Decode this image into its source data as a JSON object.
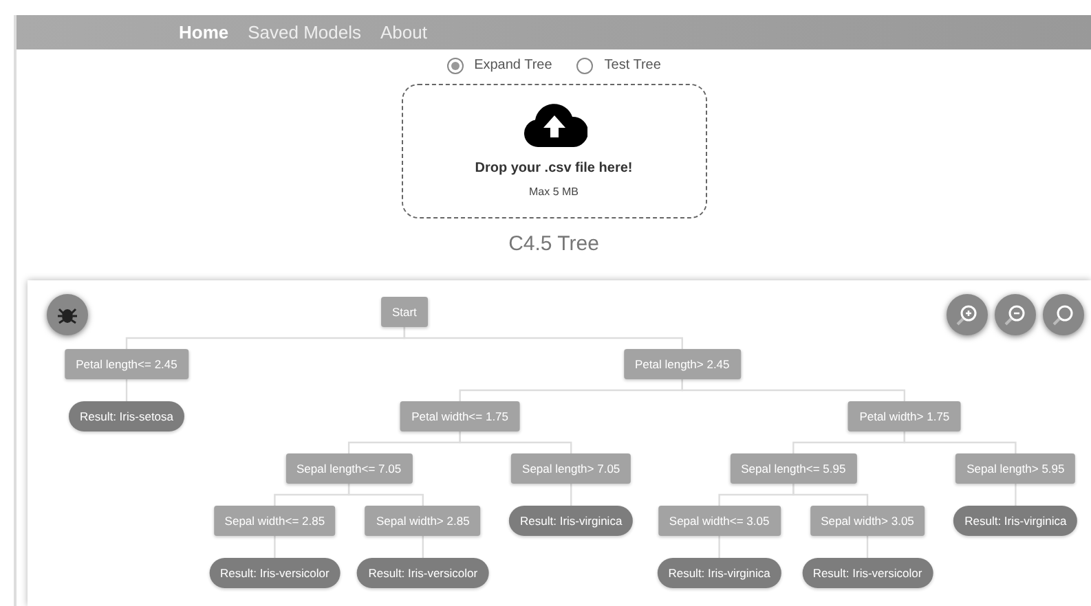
{
  "nav": [
    {
      "label": "Home",
      "selected": true
    },
    {
      "label": "Saved Models",
      "selected": false
    },
    {
      "label": "About",
      "selected": false
    }
  ],
  "mode_options": [
    {
      "label": "Expand Tree",
      "selected": true
    },
    {
      "label": "Test Tree",
      "selected": false
    }
  ],
  "dropzone": {
    "title": "Drop your .csv file here!",
    "hint": "Max 5 MB"
  },
  "heading": "C4.5 Tree",
  "tree": {
    "kind": "split",
    "label": "Start",
    "children": [
      {
        "kind": "split",
        "label": "Petal length<= 2.45",
        "children": [
          {
            "kind": "result",
            "label": "Result: Iris-setosa"
          }
        ]
      },
      {
        "kind": "split",
        "label": "Petal length> 2.45",
        "children": [
          {
            "kind": "split",
            "label": "Petal width<= 1.75",
            "children": [
              {
                "kind": "split",
                "label": "Sepal length<= 7.05",
                "children": [
                  {
                    "kind": "split",
                    "label": "Sepal width<= 2.85",
                    "children": [
                      {
                        "kind": "result",
                        "label": "Result: Iris-versicolor"
                      }
                    ]
                  },
                  {
                    "kind": "split",
                    "label": "Sepal width> 2.85",
                    "children": [
                      {
                        "kind": "result",
                        "label": "Result: Iris-versicolor"
                      }
                    ]
                  }
                ]
              },
              {
                "kind": "split",
                "label": "Sepal length> 7.05",
                "children": [
                  {
                    "kind": "result",
                    "label": "Result: Iris-virginica"
                  }
                ]
              }
            ]
          },
          {
            "kind": "split",
            "label": "Petal width> 1.75",
            "children": [
              {
                "kind": "split",
                "label": "Sepal length<= 5.95",
                "children": [
                  {
                    "kind": "split",
                    "label": "Sepal width<= 3.05",
                    "children": [
                      {
                        "kind": "result",
                        "label": "Result: Iris-virginica"
                      }
                    ]
                  },
                  {
                    "kind": "split",
                    "label": "Sepal width> 3.05",
                    "children": [
                      {
                        "kind": "result",
                        "label": "Result: Iris-versicolor"
                      }
                    ]
                  }
                ]
              },
              {
                "kind": "split",
                "label": "Sepal length> 5.95",
                "children": [
                  {
                    "kind": "result",
                    "label": "Result: Iris-virginica"
                  }
                ]
              }
            ]
          }
        ]
      }
    ]
  }
}
